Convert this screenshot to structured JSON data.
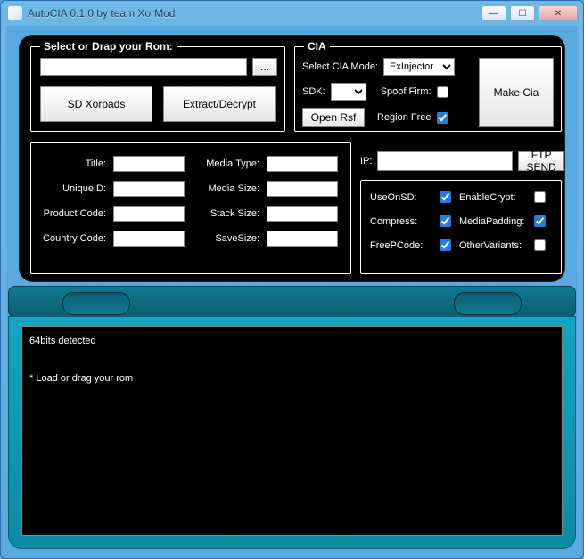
{
  "window": {
    "title": "AutoCIA 0.1.0 by team XorMod"
  },
  "rom": {
    "legend": "Select or Drap your Rom:",
    "path": "",
    "browse": "...",
    "xorpads": "SD Xorpads",
    "extract": "Extract/Decrypt"
  },
  "cia": {
    "legend": "CIA",
    "mode_label": "Select CIA Mode:",
    "mode_value": "ExInjector",
    "sdk_label": "SDK:",
    "sdk_value": "",
    "spoof_label": "Spoof Firm:",
    "spoof_checked": false,
    "openrsf": "Open Rsf",
    "region_label": "Region Free",
    "region_checked": true,
    "make": "Make Cia"
  },
  "ip": {
    "label": "IP:",
    "value": "",
    "send": "FTP SEND"
  },
  "info": {
    "title_label": "Title:",
    "title": "",
    "uniqueid_label": "UniqueID:",
    "uniqueid": "",
    "product_label": "Product Code:",
    "product": "",
    "country_label": "Country Code:",
    "country": "",
    "mediatype_label": "Media Type:",
    "mediatype": "",
    "mediasize_label": "Media Size:",
    "mediasize": "",
    "stacksize_label": "Stack Size:",
    "stacksize": "",
    "savesize_label": "SaveSize:",
    "savesize": ""
  },
  "opts": {
    "useonsd_label": "UseOnSD:",
    "useonsd": true,
    "enablecrypt_label": "EnableCrypt:",
    "enablecrypt": false,
    "compress_label": "Compress:",
    "compress": true,
    "mediapadding_label": "MediaPadding:",
    "mediapadding": true,
    "freepcode_label": "FreePCode:",
    "freepcode": true,
    "othervariants_label": "OtherVariants:",
    "othervariants": false
  },
  "console": {
    "line1": "64bits detected",
    "line2": "* Load or drag your rom"
  }
}
